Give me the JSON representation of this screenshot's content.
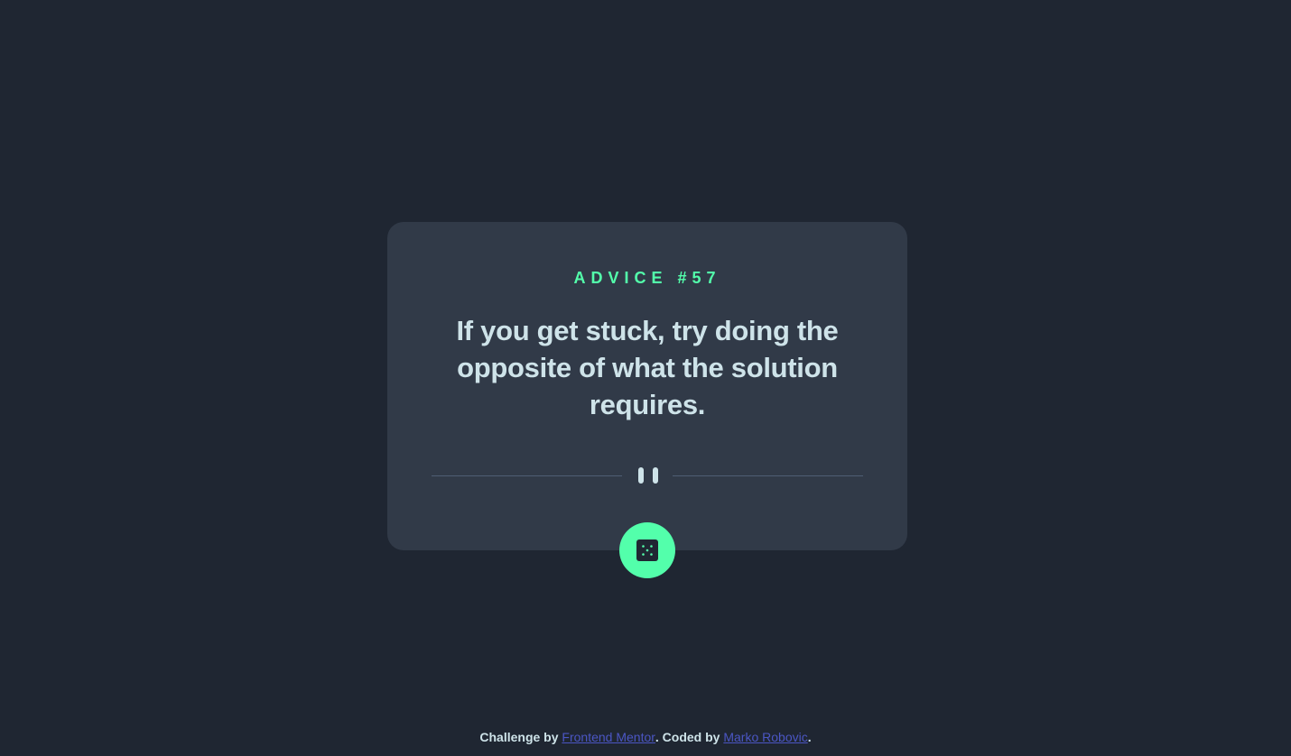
{
  "advice": {
    "id_label": "ADVICE #57",
    "text": "If you get stuck, try doing the opposite of what the solution requires."
  },
  "icons": {
    "divider": "pause-divider-icon",
    "button": "dice-icon"
  },
  "footer": {
    "prefix": "Challenge by ",
    "challenge_link": "Frontend Mentor",
    "middle": ". Coded by ",
    "author_link": "Marko Robovic",
    "suffix": "."
  },
  "colors": {
    "background": "#1f2632",
    "card": "#313a48",
    "accent": "#53ffab",
    "text": "#cee3e9",
    "link": "#4b56c4"
  }
}
